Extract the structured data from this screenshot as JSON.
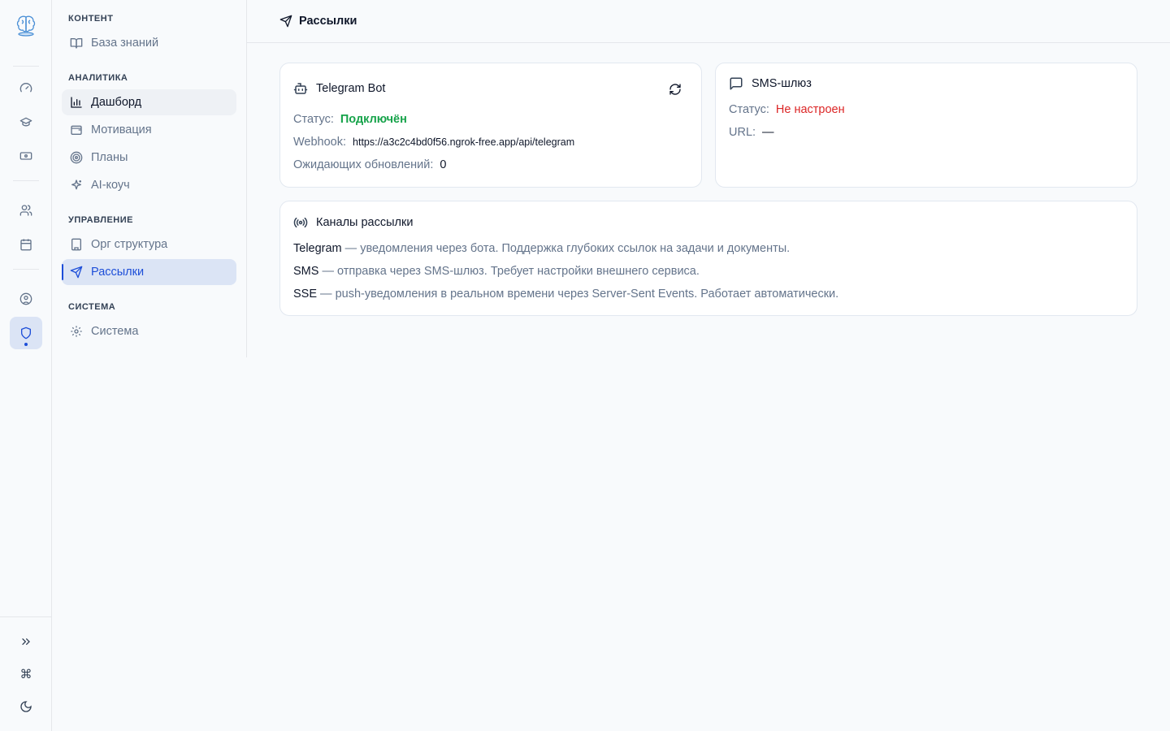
{
  "rail": {
    "logo": "brain-logo",
    "items": [
      "gauge-icon",
      "graduation-cap-icon",
      "banknote-icon",
      "users-icon",
      "calendar-icon",
      "user-circle-icon",
      "shield-icon"
    ],
    "bottom": [
      "chevrons-right-icon",
      "command-icon",
      "moon-icon"
    ],
    "command_glyph": "⌘",
    "expand_glyph": "»"
  },
  "nav": {
    "sections": [
      {
        "title": "КОНТЕНТ",
        "items": [
          {
            "label": "База знаний",
            "icon": "book-open-icon"
          }
        ]
      },
      {
        "title": "АНАЛИТИКА",
        "items": [
          {
            "label": "Дашборд",
            "icon": "bar-chart-icon"
          },
          {
            "label": "Мотивация",
            "icon": "wallet-icon"
          },
          {
            "label": "Планы",
            "icon": "target-icon"
          },
          {
            "label": "AI-коуч",
            "icon": "sparkles-icon"
          }
        ]
      },
      {
        "title": "УПРАВЛЕНИЕ",
        "items": [
          {
            "label": "Орг структура",
            "icon": "building-icon"
          },
          {
            "label": "Рассылки",
            "icon": "send-icon"
          }
        ]
      },
      {
        "title": "СИСТЕМА",
        "items": [
          {
            "label": "Система",
            "icon": "settings-icon"
          }
        ]
      }
    ]
  },
  "header": {
    "title": "Рассылки"
  },
  "telegram": {
    "title": "Telegram Bot",
    "status_label": "Статус:",
    "status_value": "Подключён",
    "webhook_label": "Webhook:",
    "webhook_value": "https://a3c2c4bd0f56.ngrok-free.app/api/telegram",
    "pending_label": "Ожидающих обновлений:",
    "pending_value": "0"
  },
  "sms": {
    "title": "SMS-шлюз",
    "status_label": "Статус:",
    "status_value": "Не настроен",
    "url_label": "URL:",
    "url_value": "—"
  },
  "channels": {
    "title": "Каналы рассылки",
    "lines": [
      {
        "name": "Telegram",
        "text": " — уведомления через бота. Поддержка глубоких ссылок на задачи и документы."
      },
      {
        "name": "SMS",
        "text": " — отправка через SMS-шлюз. Требует настройки внешнего сервиса."
      },
      {
        "name": "SSE",
        "text": " — push-уведомления в реальном времени через Server-Sent Events. Работает автоматически."
      }
    ]
  },
  "colors": {
    "accent": "#1d4ed8",
    "ok": "#16a34a",
    "error": "#dc2626"
  }
}
